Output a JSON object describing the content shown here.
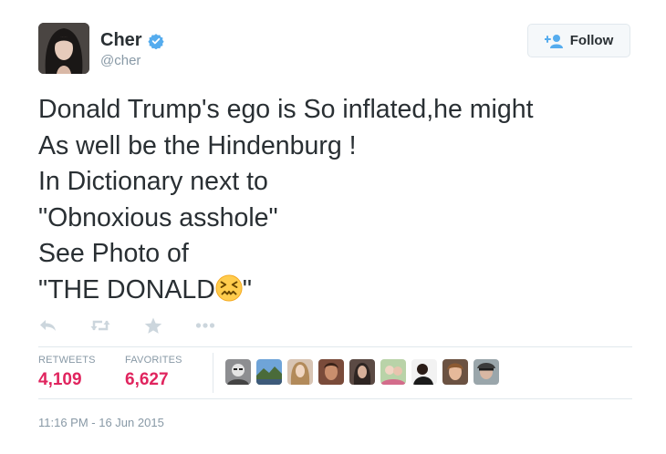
{
  "user": {
    "name": "Cher",
    "handle": "@cher",
    "verified": true,
    "avatar_icon": "profile-photo"
  },
  "follow_button": {
    "label": "Follow",
    "icon": "add-person-icon",
    "accent": "#55acee"
  },
  "tweet": {
    "lines": [
      "Donald Trump's ego is So inflated,he might",
      "As well be the Hindenburg !",
      "In Dictionary next to",
      "\"Obnoxious asshole\"",
      "See Photo of",
      "\"THE DONALD",
      "\""
    ],
    "emoji": "confounded-face"
  },
  "actions": [
    "reply-icon",
    "retweet-icon",
    "favorite-icon",
    "more-icon"
  ],
  "stats": {
    "retweets_label": "RETWEETS",
    "retweets_value": "4,109",
    "favorites_label": "FAVORITES",
    "favorites_value": "6,627",
    "value_color": "#e0245e"
  },
  "favoriters_count": 9,
  "timestamp": "11:16 PM - 16 Jun 2015"
}
